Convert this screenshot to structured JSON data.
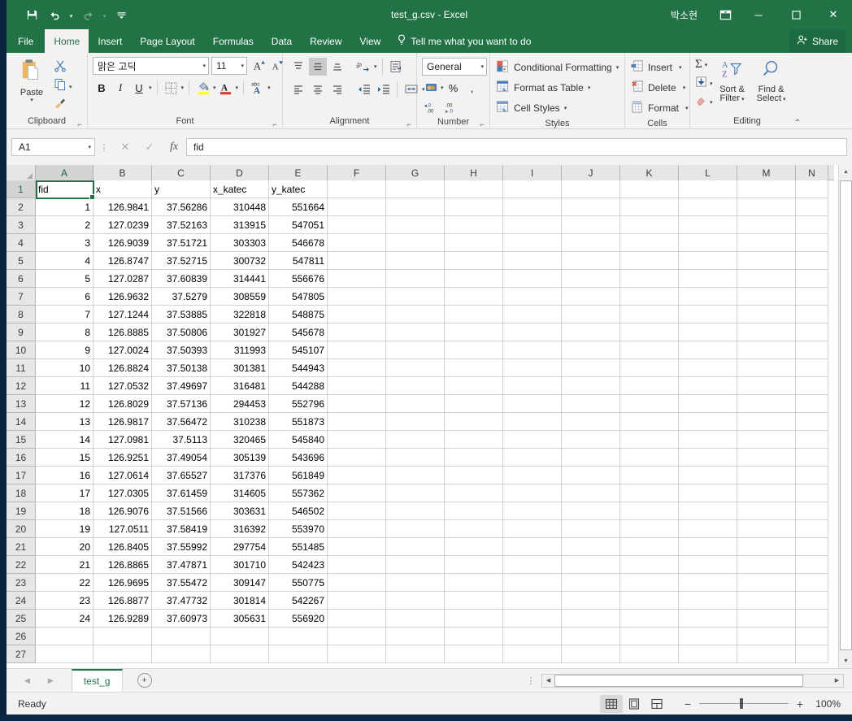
{
  "window": {
    "title": "test_g.csv  -  Excel",
    "user": "박소현",
    "quick_access": [
      {
        "name": "save",
        "glyph": "💾"
      },
      {
        "name": "undo",
        "glyph": "↶"
      },
      {
        "name": "redo",
        "glyph": "↷"
      },
      {
        "name": "customize",
        "glyph": "═"
      }
    ],
    "ribbon_display_options": "ribbon-display-options",
    "minimize": "─",
    "maximize": "☐",
    "close": "✕"
  },
  "ribbon": {
    "tabs": [
      {
        "label": "File",
        "active": false
      },
      {
        "label": "Home",
        "active": true
      },
      {
        "label": "Insert",
        "active": false
      },
      {
        "label": "Page Layout",
        "active": false
      },
      {
        "label": "Formulas",
        "active": false
      },
      {
        "label": "Data",
        "active": false
      },
      {
        "label": "Review",
        "active": false
      },
      {
        "label": "View",
        "active": false
      }
    ],
    "tell_me": "Tell me what you want to do",
    "share": "Share",
    "groups": {
      "clipboard": {
        "label": "Clipboard",
        "paste": "Paste",
        "cut": "Cut",
        "copy": "Copy",
        "format_painter": "Format Painter"
      },
      "font": {
        "label": "Font",
        "font_name": "맑은 고딕",
        "font_size": "11",
        "grow_font": "A",
        "shrink_font": "A",
        "bold": "B",
        "italic": "I",
        "underline": "U",
        "borders": "borders",
        "fill_color": "fill-color",
        "font_color": "A",
        "phonetic": "abc"
      },
      "alignment": {
        "label": "Alignment",
        "align_top": "align-top",
        "align_middle": "align-middle",
        "align_bottom": "align-bottom",
        "orientation": "orientation",
        "align_left": "align-left",
        "align_center": "align-center",
        "align_right": "align-right",
        "decrease_indent": "decrease-indent",
        "increase_indent": "increase-indent",
        "wrap_text": "Wrap Text",
        "merge_center": "Merge & Center"
      },
      "number": {
        "label": "Number",
        "format": "General",
        "accounting": "accounting-number-format",
        "percent": "%",
        "comma": ",",
        "increase_decimal": "increase-decimal",
        "decrease_decimal": "decrease-decimal"
      },
      "styles": {
        "label": "Styles",
        "conditional_formatting": "Conditional Formatting",
        "format_as_table": "Format as Table",
        "cell_styles": "Cell Styles"
      },
      "cells": {
        "label": "Cells",
        "insert": "Insert",
        "delete": "Delete",
        "format": "Format"
      },
      "editing": {
        "label": "Editing",
        "autosum": "Σ",
        "fill": "fill",
        "clear": "clear",
        "sort_filter_l1": "Sort &",
        "sort_filter_l2": "Filter",
        "find_select_l1": "Find &",
        "find_select_l2": "Select"
      }
    }
  },
  "formula_bar": {
    "name_box": "A1",
    "cancel": "✕",
    "enter": "✓",
    "insert_function": "fx",
    "value": "fid"
  },
  "grid": {
    "columns": [
      {
        "label": "A",
        "width": 71,
        "selected": true
      },
      {
        "label": "B",
        "width": 72,
        "selected": false
      },
      {
        "label": "C",
        "width": 72,
        "selected": false
      },
      {
        "label": "D",
        "width": 72,
        "selected": false
      },
      {
        "label": "E",
        "width": 72,
        "selected": false
      },
      {
        "label": "F",
        "width": 72,
        "selected": false
      },
      {
        "label": "G",
        "width": 72,
        "selected": false
      },
      {
        "label": "H",
        "width": 72,
        "selected": false
      },
      {
        "label": "I",
        "width": 72,
        "selected": false
      },
      {
        "label": "J",
        "width": 72,
        "selected": false
      },
      {
        "label": "K",
        "width": 72,
        "selected": false
      },
      {
        "label": "L",
        "width": 72,
        "selected": false
      },
      {
        "label": "M",
        "width": 72,
        "selected": false
      },
      {
        "label": "N",
        "width": 40,
        "selected": false
      }
    ],
    "active_cell": "A1",
    "header_row": [
      "fid",
      "x",
      "y",
      "x_katec",
      "y_katec"
    ],
    "rows": [
      {
        "n": "1",
        "cells": [
          "fid",
          "x",
          "y",
          "x_katec",
          "y_katec"
        ],
        "text": true
      },
      {
        "n": "2",
        "cells": [
          "1",
          "126.9841",
          "37.56286",
          "310448",
          "551664"
        ]
      },
      {
        "n": "3",
        "cells": [
          "2",
          "127.0239",
          "37.52163",
          "313915",
          "547051"
        ]
      },
      {
        "n": "4",
        "cells": [
          "3",
          "126.9039",
          "37.51721",
          "303303",
          "546678"
        ]
      },
      {
        "n": "5",
        "cells": [
          "4",
          "126.8747",
          "37.52715",
          "300732",
          "547811"
        ]
      },
      {
        "n": "6",
        "cells": [
          "5",
          "127.0287",
          "37.60839",
          "314441",
          "556676"
        ]
      },
      {
        "n": "7",
        "cells": [
          "6",
          "126.9632",
          "37.5279",
          "308559",
          "547805"
        ]
      },
      {
        "n": "8",
        "cells": [
          "7",
          "127.1244",
          "37.53885",
          "322818",
          "548875"
        ]
      },
      {
        "n": "9",
        "cells": [
          "8",
          "126.8885",
          "37.50806",
          "301927",
          "545678"
        ]
      },
      {
        "n": "10",
        "cells": [
          "9",
          "127.0024",
          "37.50393",
          "311993",
          "545107"
        ]
      },
      {
        "n": "11",
        "cells": [
          "10",
          "126.8824",
          "37.50138",
          "301381",
          "544943"
        ]
      },
      {
        "n": "12",
        "cells": [
          "11",
          "127.0532",
          "37.49697",
          "316481",
          "544288"
        ]
      },
      {
        "n": "13",
        "cells": [
          "12",
          "126.8029",
          "37.57136",
          "294453",
          "552796"
        ]
      },
      {
        "n": "14",
        "cells": [
          "13",
          "126.9817",
          "37.56472",
          "310238",
          "551873"
        ]
      },
      {
        "n": "15",
        "cells": [
          "14",
          "127.0981",
          "37.5113",
          "320465",
          "545840"
        ]
      },
      {
        "n": "16",
        "cells": [
          "15",
          "126.9251",
          "37.49054",
          "305139",
          "543696"
        ]
      },
      {
        "n": "17",
        "cells": [
          "16",
          "127.0614",
          "37.65527",
          "317376",
          "561849"
        ]
      },
      {
        "n": "18",
        "cells": [
          "17",
          "127.0305",
          "37.61459",
          "314605",
          "557362"
        ]
      },
      {
        "n": "19",
        "cells": [
          "18",
          "126.9076",
          "37.51566",
          "303631",
          "546502"
        ]
      },
      {
        "n": "20",
        "cells": [
          "19",
          "127.0511",
          "37.58419",
          "316392",
          "553970"
        ]
      },
      {
        "n": "21",
        "cells": [
          "20",
          "126.8405",
          "37.55992",
          "297754",
          "551485"
        ]
      },
      {
        "n": "22",
        "cells": [
          "21",
          "126.8865",
          "37.47871",
          "301710",
          "542423"
        ]
      },
      {
        "n": "23",
        "cells": [
          "22",
          "126.9695",
          "37.55472",
          "309147",
          "550775"
        ]
      },
      {
        "n": "24",
        "cells": [
          "23",
          "126.8877",
          "37.47732",
          "301814",
          "542267"
        ]
      },
      {
        "n": "25",
        "cells": [
          "24",
          "126.9289",
          "37.60973",
          "305631",
          "556920"
        ]
      },
      {
        "n": "26",
        "cells": [
          "",
          "",
          "",
          "",
          ""
        ]
      },
      {
        "n": "27",
        "cells": [
          "",
          "",
          "",
          "",
          ""
        ]
      }
    ]
  },
  "sheet_bar": {
    "prev": "◀",
    "next": "▶",
    "tabs": [
      {
        "label": "test_g",
        "active": true
      }
    ],
    "add_sheet": "+"
  },
  "status_bar": {
    "status": "Ready",
    "views": [
      {
        "name": "normal-view",
        "active": true
      },
      {
        "name": "page-layout-view",
        "active": false
      },
      {
        "name": "page-break-preview",
        "active": false
      }
    ],
    "zoom_out": "−",
    "zoom_in": "+",
    "zoom_level": "100%"
  },
  "colors": {
    "excel_green": "#217346",
    "ribbon_bg": "#f3f2f1",
    "grid_line": "#d4d4d4",
    "header_bg": "#e6e6e6"
  }
}
